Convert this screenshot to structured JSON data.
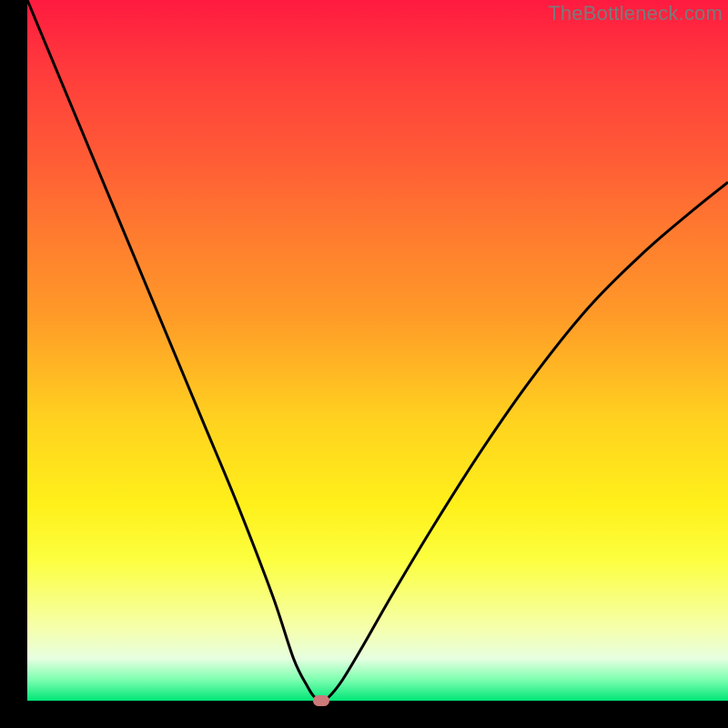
{
  "watermark": "TheBottleneck.com",
  "chart_data": {
    "type": "line",
    "title": "",
    "xlabel": "",
    "ylabel": "",
    "xlim": [
      0,
      100
    ],
    "ylim": [
      0,
      100
    ],
    "series": [
      {
        "name": "bottleneck-curve",
        "x": [
          0,
          5,
          10,
          15,
          20,
          25,
          30,
          35,
          38,
          40,
          41,
          42,
          43,
          45,
          48,
          52,
          58,
          65,
          72,
          80,
          88,
          95,
          100
        ],
        "y": [
          100,
          88,
          76,
          64,
          52,
          40,
          28,
          15,
          6,
          2,
          0.5,
          0,
          0.5,
          3,
          8,
          15,
          25,
          36,
          46,
          56,
          64,
          70,
          74
        ]
      }
    ],
    "annotations": [
      {
        "name": "minimum-marker",
        "x": 42,
        "y": 0
      }
    ],
    "background_gradient": {
      "direction": "vertical",
      "stops": [
        {
          "pct": 0,
          "color": "#ff1a40"
        },
        {
          "pct": 45,
          "color": "#ff9a28"
        },
        {
          "pct": 72,
          "color": "#fff01a"
        },
        {
          "pct": 97,
          "color": "#7dffb0"
        },
        {
          "pct": 100,
          "color": "#00e676"
        }
      ]
    }
  }
}
